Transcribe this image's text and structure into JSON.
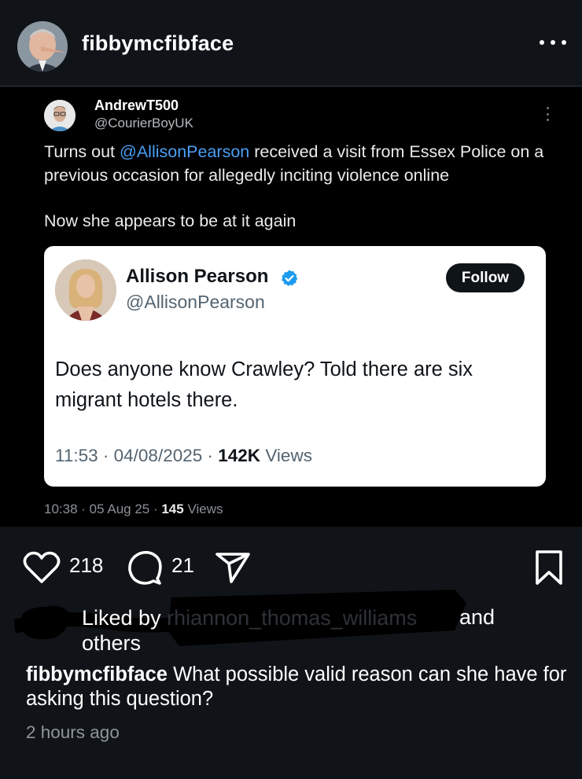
{
  "post": {
    "username": "fibbymcfibface"
  },
  "tweet": {
    "name": "AndrewT500",
    "handle": "@CourierBoyUK",
    "text_prefix": "Turns out ",
    "mention": "@AllisonPearson",
    "text_suffix": " received a visit from Essex Police on a previous occasion for allegedly inciting violence online",
    "text_line2": "Now she appears to be at it again",
    "time": "10:38",
    "date": "05 Aug 25",
    "views_count": "145",
    "views_label": "Views"
  },
  "quoted": {
    "name": "Allison Pearson",
    "handle": "@AllisonPearson",
    "follow_label": "Follow",
    "text": "Does anyone know Crawley? Told there are six migrant hotels there.",
    "time": "11:53",
    "date": "04/08/2025",
    "views_count": "142K",
    "views_label": "Views",
    "verified_color": "#1d9bf0"
  },
  "actions": {
    "likes": "218",
    "comments": "21"
  },
  "liked_by": {
    "prefix": "Liked by",
    "obscured_user": "rhiannon_thomas_williams",
    "suffix": "and",
    "others": "others"
  },
  "caption": {
    "username": "fibbymcfibface",
    "text": "What possible valid reason can she have for asking this question?"
  },
  "time_ago": "2 hours ago",
  "colors": {
    "background": "#101419",
    "mention": "#4a9ff5"
  }
}
